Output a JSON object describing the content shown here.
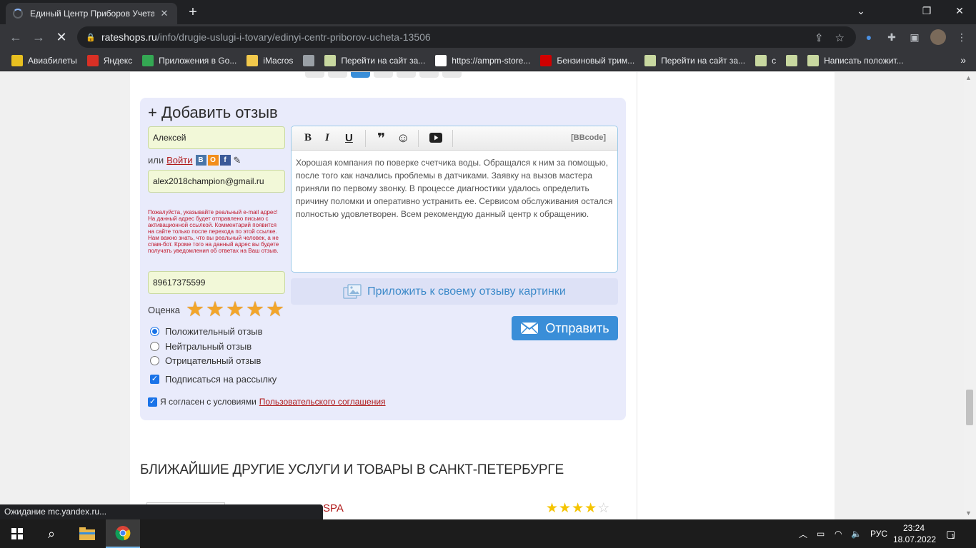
{
  "browser": {
    "tab_title": "Единый Центр Приборов Учета",
    "url_host": "rateshops.ru",
    "url_path": "/info/drugie-uslugi-i-tovary/edinyi-centr-priborov-ucheta-13506"
  },
  "bookmarks": [
    {
      "label": "Авиабилеты",
      "icon": "plane-icon",
      "color": "#e8c020"
    },
    {
      "label": "Яндекс",
      "icon": "yandex-icon",
      "color": "#d93025"
    },
    {
      "label": "Приложения в Go...",
      "icon": "google-play-icon",
      "color": "#34a853"
    },
    {
      "label": "iMacros",
      "icon": "folder-icon",
      "color": "#f2c94c"
    },
    {
      "label": "",
      "icon": "globe-icon",
      "color": "#9aa0a6"
    },
    {
      "label": "Перейти на сайт за...",
      "icon": "site-icon",
      "color": "#c8d8a0"
    },
    {
      "label": "https://ampm-store...",
      "icon": "ampm-icon",
      "color": "#ffffff"
    },
    {
      "label": "Бензиновый трим...",
      "icon": "vi-icon",
      "color": "#d00000"
    },
    {
      "label": "Перейти на сайт за...",
      "icon": "site-icon",
      "color": "#c8d8a0"
    },
    {
      "label": "с",
      "icon": "site-icon",
      "color": "#c8d8a0"
    },
    {
      "label": "",
      "icon": "site-icon",
      "color": "#c8d8a0"
    },
    {
      "label": "Написать положит...",
      "icon": "site-icon",
      "color": "#c8d8a0"
    }
  ],
  "form": {
    "title": "+ Добавить отзыв",
    "name_value": "Алексей",
    "or_text": "или",
    "login_link": "Войти",
    "email_value": "alex2018champion@gmail.ru",
    "warning": "Пожалуйста, указывайте реальный e-mail адрес! На данный адрес будет отправлено письмо с активационной ссылкой. Комментарий появится на сайте только после перехода по этой ссылке. Нам важно знать, что вы реальный человек, а не спам-бот. Кроме того на данный адрес вы будете получать уведомления об ответах на Ваш отзыв.",
    "phone_value": "89617375599",
    "rating_label": "Оценка",
    "rating_value": 5,
    "rating_max": 5,
    "review_types": [
      {
        "label": "Положительный отзыв",
        "checked": true
      },
      {
        "label": "Нейтральный отзыв",
        "checked": false
      },
      {
        "label": "Отрицательный отзыв",
        "checked": false
      }
    ],
    "subscribe_label": "Подписаться на рассылку",
    "agree_text": "Я согласен с условиями",
    "agree_link": "Пользовательского соглашения",
    "bbcode_label": "[BBcode]",
    "review_text": "Хорошая компания по поверке счетчика воды. Обращался к ним за помощью, после того как начались проблемы в датчиками. Заявку на вызов мастера приняли по первому звонку. В процессе диагностики удалось определить причину поломки и оперативно устранить ее. Сервисом обслуживания остался полностью удовлетворен. Всем рекомендую данный центр к обращению.",
    "attach_label": "Приложить к своему отзыву картинки",
    "send_label": "Отправить"
  },
  "nearby": {
    "title": "БЛИЖАЙШИЕ ДРУГИЕ УСЛУГИ И ТОВАРЫ В САНКТ-ПЕТЕРБУРГЕ",
    "item_name_partial": "L SPA",
    "item_rating": 4,
    "item_rating_max": 5
  },
  "status_text": "Ожидание mc.yandex.ru...",
  "taskbar": {
    "lang": "РУС",
    "time": "23:24",
    "date": "18.07.2022",
    "notifications": "1"
  },
  "colors": {
    "accent": "#3a8ed8",
    "link": "#b01818",
    "form_bg": "#e9ebfb",
    "input_bg": "#f2f8d8"
  }
}
